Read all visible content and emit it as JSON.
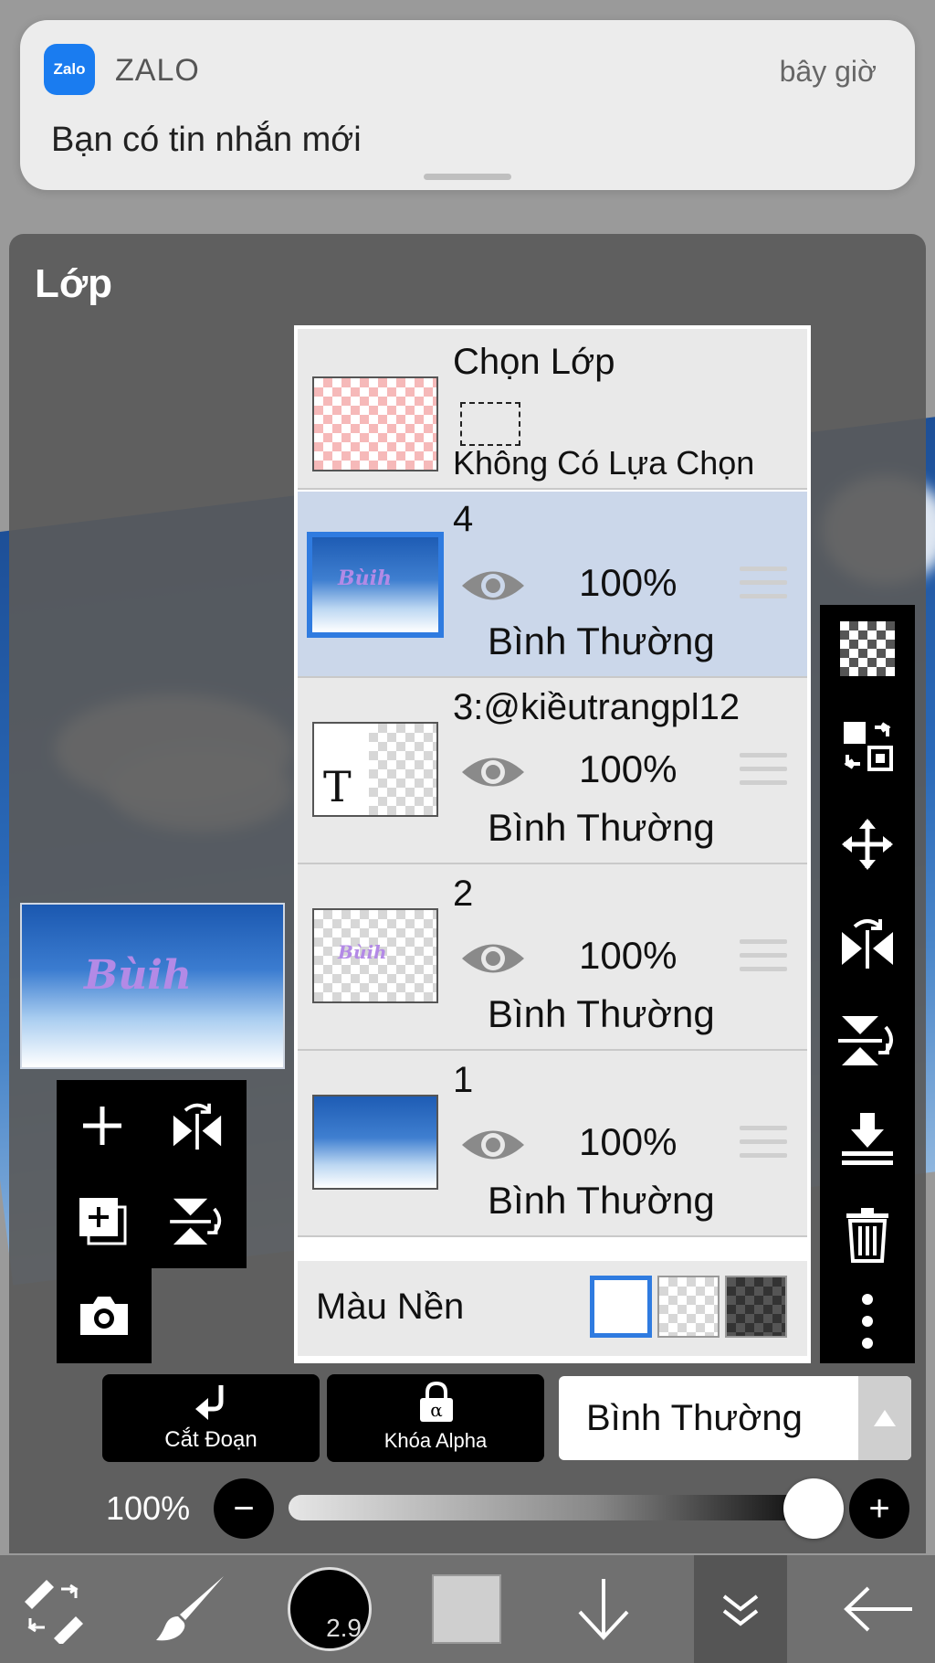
{
  "notification": {
    "app_logo_text": "Zalo",
    "app_name": "ZALO",
    "time": "bây giờ",
    "message": "Bạn có tin nhắn mới"
  },
  "panel": {
    "title": "Lớp"
  },
  "selection_layer": {
    "title": "Chọn Lớp",
    "subtitle": "Không Có Lựa Chọn"
  },
  "layers": [
    {
      "name": "4",
      "opacity": "100%",
      "blend": "Bình Thường",
      "selected": true,
      "thumb": "sky-watermark"
    },
    {
      "name": "3:@kiềutrangpl12",
      "opacity": "100%",
      "blend": "Bình Thường",
      "selected": false,
      "thumb": "text",
      "thumb_glyph": "T"
    },
    {
      "name": "2",
      "opacity": "100%",
      "blend": "Bình Thường",
      "selected": false,
      "thumb": "transparent-watermark"
    },
    {
      "name": "1",
      "opacity": "100%",
      "blend": "Bình Thường",
      "selected": false,
      "thumb": "sky"
    }
  ],
  "watermark_text": "Bùih",
  "background_color": {
    "label": "Màu Nền",
    "options": [
      "white",
      "transparent",
      "dark-checker"
    ],
    "selected": "white"
  },
  "right_toolbar": [
    "new-transparent-layer-icon",
    "swap-layers-icon",
    "move-icon",
    "flip-horizontal-icon",
    "flip-vertical-icon",
    "merge-down-icon",
    "trash-icon",
    "more-icon"
  ],
  "left_toolbar": [
    "add-layer-icon",
    "flip-layer-icon",
    "duplicate-layer-icon",
    "rotate-layer-icon",
    "camera-icon"
  ],
  "bottom_controls": {
    "clip_label": "Cắt Đoạn",
    "alpha_lock_label": "Khóa Alpha",
    "blend_mode": "Bình Thường",
    "opacity_label": "100%",
    "opacity_value": 1.0,
    "minus": "−",
    "plus": "+"
  },
  "bottom_toolbar": {
    "brush_size": "2.9",
    "tools": [
      "transform-icon",
      "brush-icon",
      "brush-size-icon",
      "color-swatch",
      "arrow-down-icon",
      "layers-icon",
      "back-arrow-icon"
    ]
  },
  "colors": {
    "accent": "#2f7be0",
    "zalo": "#1a7cf0",
    "selected_row": "#cbd7ea"
  }
}
